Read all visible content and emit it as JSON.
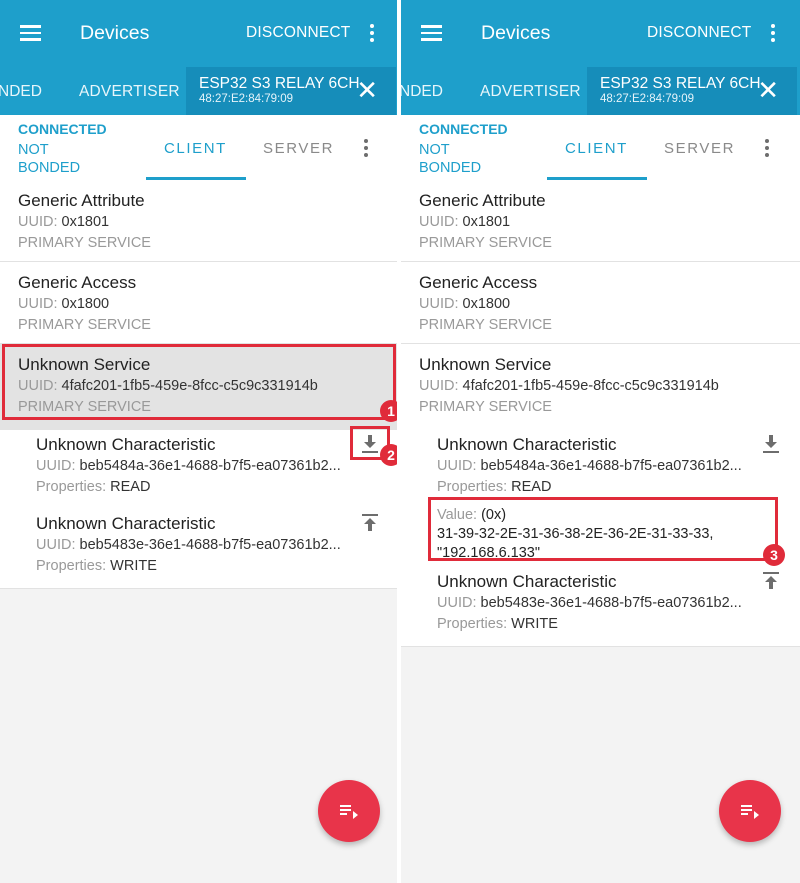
{
  "appbar": {
    "title": "Devices",
    "disconnect_label": "DISCONNECT"
  },
  "tabs": {
    "bonded_label": "NDED",
    "advertiser_label": "ADVERTISER",
    "device_name": "ESP32 S3 RELAY 6CH",
    "device_mac": "48:27:E2:84:79:09",
    "close_glyph": "✕"
  },
  "subbar": {
    "status": "CONNECTED",
    "bond": "NOT BONDED",
    "client_label": "CLIENT",
    "server_label": "SERVER"
  },
  "services": [
    {
      "name": "Generic Attribute",
      "uuid_label": "UUID:",
      "uuid": "0x1801",
      "type": "PRIMARY SERVICE"
    },
    {
      "name": "Generic Access",
      "uuid_label": "UUID:",
      "uuid": "0x1800",
      "type": "PRIMARY SERVICE"
    },
    {
      "name": "Unknown Service",
      "uuid_label": "UUID:",
      "uuid": "4fafc201-1fb5-459e-8fcc-c5c9c331914b",
      "type": "PRIMARY SERVICE"
    }
  ],
  "characteristics": [
    {
      "name": "Unknown Characteristic",
      "uuid_label": "UUID:",
      "uuid": "beb5484a-36e1-4688-b7f5-ea07361b2...",
      "props_label": "Properties:",
      "props": "READ",
      "icon": "download-icon"
    },
    {
      "name": "Unknown Characteristic",
      "uuid_label": "UUID:",
      "uuid": "beb5483e-36e1-4688-b7f5-ea07361b2...",
      "props_label": "Properties:",
      "props": "WRITE",
      "icon": "upload-icon"
    }
  ],
  "read_value": {
    "label": "Value:",
    "format": "(0x)",
    "hex": "31-39-32-2E-31-36-38-2E-36-2E-31-33-33,",
    "string": "\"192.168.6.133\""
  },
  "badges": {
    "one": "1",
    "two": "2",
    "three": "3"
  },
  "colors": {
    "primary": "#1e9fcb",
    "fab": "#e8344a",
    "highlight": "#e02b3a"
  }
}
